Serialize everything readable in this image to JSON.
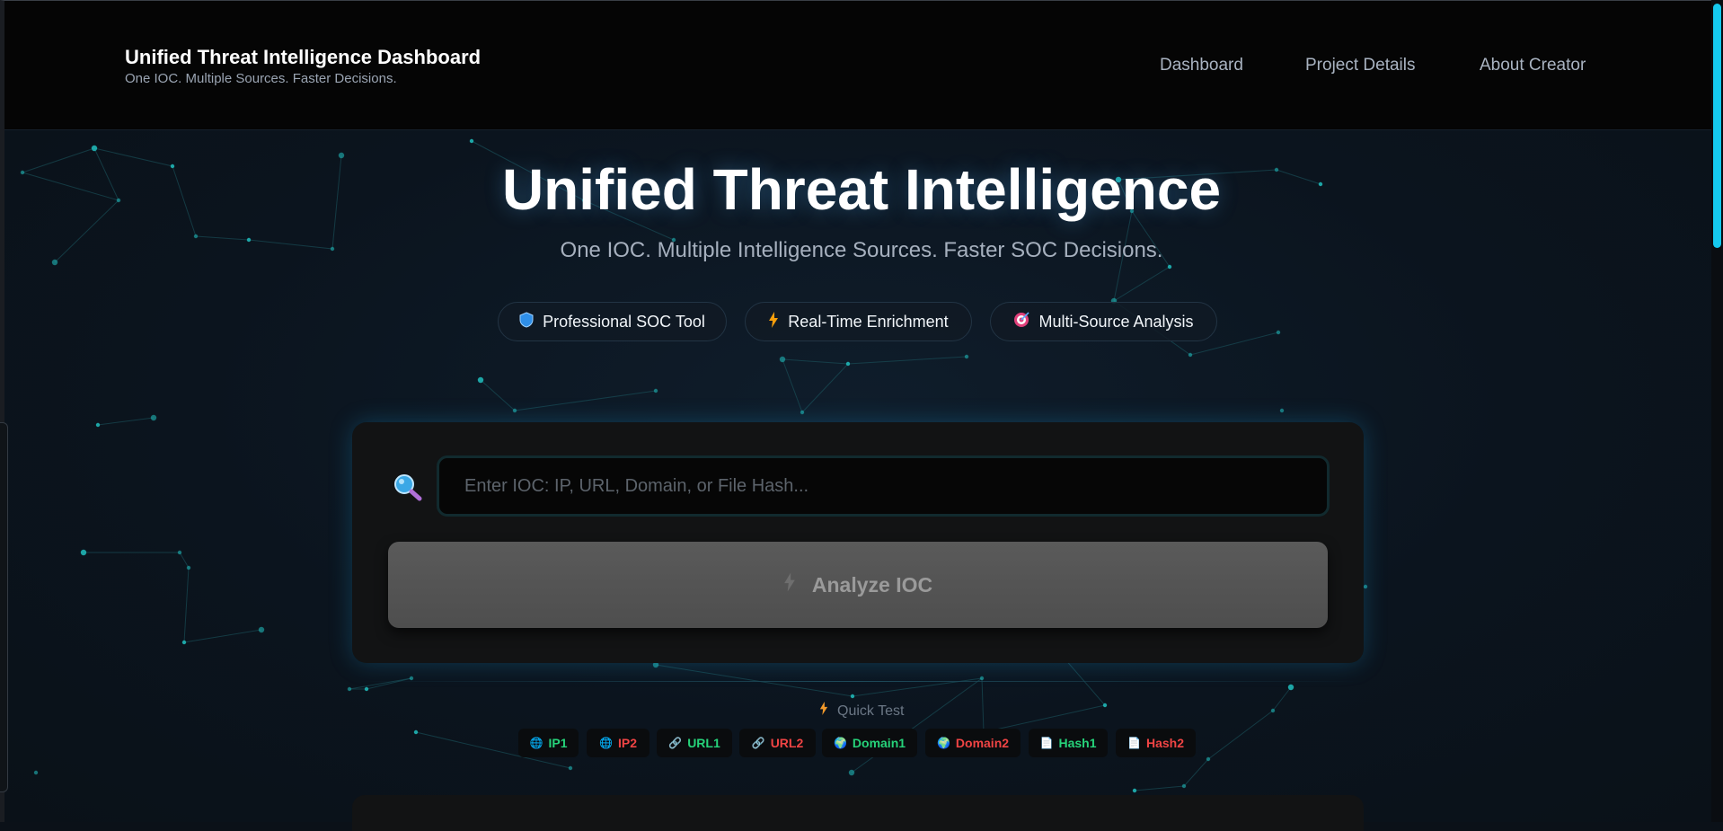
{
  "header": {
    "title": "Unified Threat Intelligence Dashboard",
    "subtitle": "One IOC. Multiple Sources. Faster Decisions.",
    "nav": [
      "Dashboard",
      "Project Details",
      "About Creator"
    ]
  },
  "hero": {
    "title": "Unified Threat Intelligence",
    "subtitle": "One IOC. Multiple Intelligence Sources. Faster SOC Decisions.",
    "pills": [
      {
        "icon": "shield-icon",
        "label": "Professional SOC Tool"
      },
      {
        "icon": "lightning-icon",
        "label": "Real-Time Enrichment"
      },
      {
        "icon": "target-icon",
        "label": "Multi-Source Analysis"
      }
    ]
  },
  "search": {
    "placeholder": "Enter IOC: IP, URL, Domain, or File Hash...",
    "value": "",
    "button_label": "Analyze IOC"
  },
  "quick_test": {
    "label": "Quick Test",
    "chips": [
      {
        "icon": "globe-icon",
        "label": "IP1",
        "color": "#26d37a"
      },
      {
        "icon": "globe-icon",
        "label": "IP2",
        "color": "#ef4444"
      },
      {
        "icon": "link-icon",
        "label": "URL1",
        "color": "#26d37a"
      },
      {
        "icon": "link-icon",
        "label": "URL2",
        "color": "#ef4444"
      },
      {
        "icon": "earth-icon",
        "label": "Domain1",
        "color": "#26d37a"
      },
      {
        "icon": "earth-icon",
        "label": "Domain2",
        "color": "#ef4444"
      },
      {
        "icon": "document-icon",
        "label": "Hash1",
        "color": "#26d37a"
      },
      {
        "icon": "document-icon",
        "label": "Hash2",
        "color": "#ef4444"
      }
    ]
  },
  "colors": {
    "accent": "#15c8ee",
    "safe": "#26d37a",
    "malicious": "#ef4444",
    "background": "#0b1118"
  }
}
